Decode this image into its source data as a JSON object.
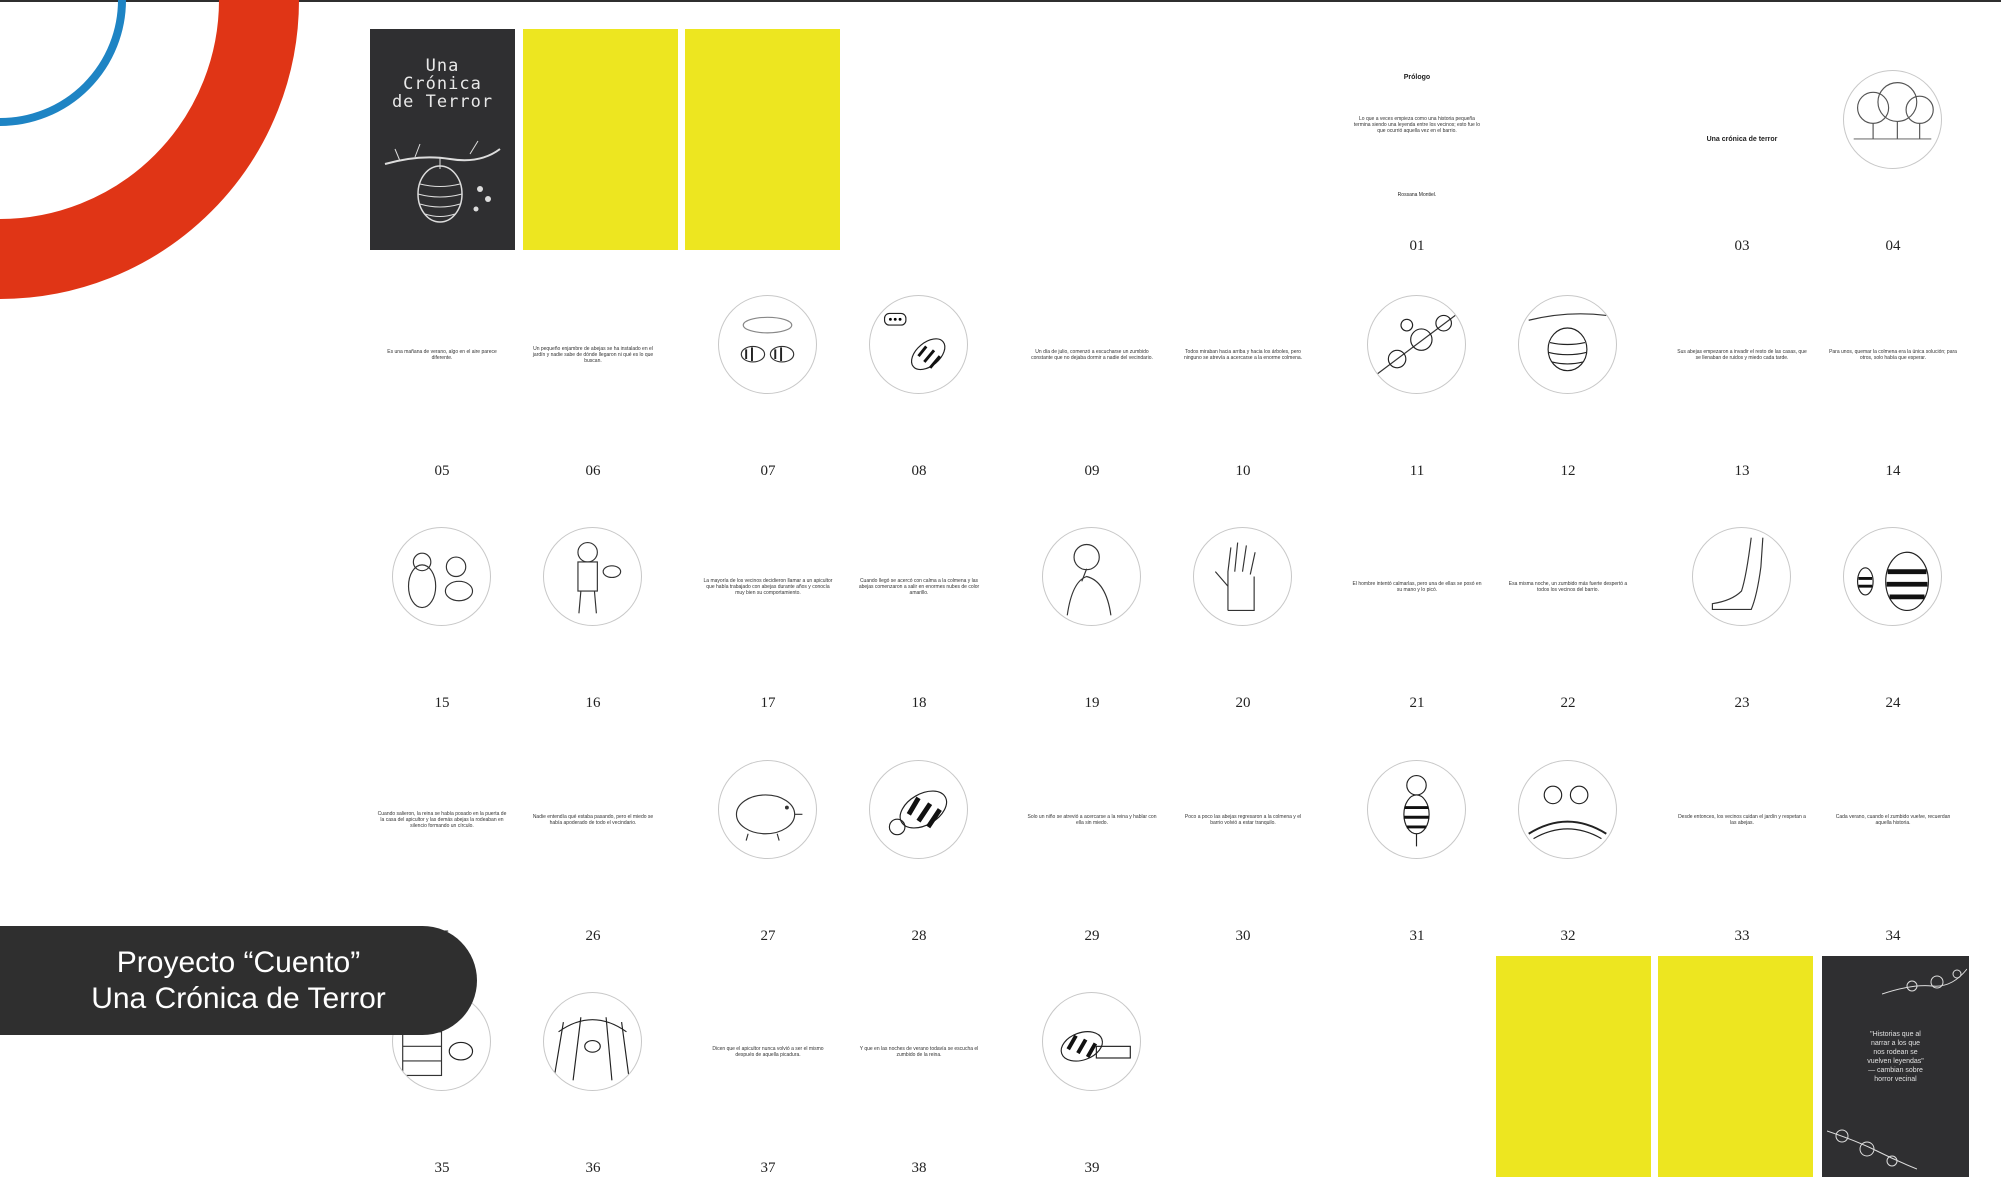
{
  "cover": {
    "title": "Una\nCrónica\nde Terror"
  },
  "back_cover": {
    "quote": "\"Historias que al\nnarrar a los que\nnos rodean se\nvuelven leyendas\"\n— cambian sobre\nhorror vecinal"
  },
  "label": {
    "line1": "Proyecto “Cuento”",
    "line2": "Una Crónica de Terror"
  },
  "pages": [
    {
      "n": "01",
      "kind": "prologue",
      "title": "Prólogo",
      "text": "Lo que a veces empieza como una historia pequeña termina siendo una leyenda entre los vecinos; esto fue lo que ocurrió aquella vez en el barrio.",
      "sig": "Rossana Montiel."
    },
    {
      "n": "03",
      "kind": "title",
      "title": "Una crónica de terror"
    },
    {
      "n": "04",
      "kind": "illus",
      "icon": "trees-icon"
    },
    {
      "n": "05",
      "kind": "text",
      "text": "Es una mañana de verano, algo en el aire parece diferente."
    },
    {
      "n": "06",
      "kind": "text",
      "text": "Un pequeño enjambre de abejas se ha instalado en el jardín y nadie sabe de dónde llegaron ni qué es lo que buscan."
    },
    {
      "n": "07",
      "kind": "illus",
      "icon": "bees-icon"
    },
    {
      "n": "08",
      "kind": "illus",
      "icon": "bee-talking-icon"
    },
    {
      "n": "09",
      "kind": "text",
      "text": "Un día de julio, comenzó a escucharse un zumbido constante que no dejaba dormir a nadie del vecindario."
    },
    {
      "n": "10",
      "kind": "text",
      "text": "Todos miraban hacia arriba y hacia los árboles, pero ninguno se atrevía a acercarse a la enorme colmena."
    },
    {
      "n": "11",
      "kind": "illus",
      "icon": "flowers-icon"
    },
    {
      "n": "12",
      "kind": "illus",
      "icon": "hive-branch-icon"
    },
    {
      "n": "13",
      "kind": "text",
      "text": "Sus abejas empezaron a invadir el resto de las casas, que se llenaban de ruidos y miedo cada tarde."
    },
    {
      "n": "14",
      "kind": "text",
      "text": "Para unos, quemar la colmena era la única solución; para otros, solo había que esperar."
    },
    {
      "n": "15",
      "kind": "illus",
      "icon": "bear-bee-icon"
    },
    {
      "n": "16",
      "kind": "illus",
      "icon": "beekeeper-icon"
    },
    {
      "n": "17",
      "kind": "text",
      "text": "La mayoría de los vecinos decidieron llamar a un apicultor que había trabajado con abejas durante años y conocía muy bien su comportamiento."
    },
    {
      "n": "18",
      "kind": "text",
      "text": "Cuando llegó se acercó con calma a la colmena y las abejas comenzaron a salir en enormes nubes de color amarillo."
    },
    {
      "n": "19",
      "kind": "illus",
      "icon": "man-thinking-icon"
    },
    {
      "n": "20",
      "kind": "illus",
      "icon": "hand-icon"
    },
    {
      "n": "21",
      "kind": "text",
      "text": "El hombre intentó calmarlas, pero una de ellas se posó en su mano y lo picó."
    },
    {
      "n": "22",
      "kind": "text",
      "text": "Esa misma noche, un zumbido más fuerte despertó a todos los vecinos del barrio."
    },
    {
      "n": "23",
      "kind": "illus",
      "icon": "leg-icon"
    },
    {
      "n": "24",
      "kind": "illus",
      "icon": "angry-bees-icon"
    },
    {
      "n": "25",
      "kind": "text",
      "text": "Cuando salieron, la reina se había posado en la puerta de la casa del apicultor y las demás abejas la rodeaban en silencio formando un círculo."
    },
    {
      "n": "26",
      "kind": "text",
      "text": "Nadie entendía qué estaba pasando, pero el miedo se había apoderado de todo el vecindario."
    },
    {
      "n": "27",
      "kind": "illus",
      "icon": "mole-icon"
    },
    {
      "n": "28",
      "kind": "illus",
      "icon": "bee-flying-icon"
    },
    {
      "n": "29",
      "kind": "text",
      "text": "Solo un niño se atrevió a acercarse a la reina y hablar con ella sin miedo."
    },
    {
      "n": "30",
      "kind": "text",
      "text": "Poco a poco las abejas regresaron a la colmena y el barrio volvió a estar tranquilo."
    },
    {
      "n": "31",
      "kind": "illus",
      "icon": "bee-standing-icon"
    },
    {
      "n": "32",
      "kind": "illus",
      "icon": "bees-group-icon"
    },
    {
      "n": "33",
      "kind": "text",
      "text": "Desde entonces, los vecinos cuidan el jardín y respetan a las abejas."
    },
    {
      "n": "34",
      "kind": "text",
      "text": "Cada verano, cuando el zumbido vuelve, recuerdan aquella historia."
    },
    {
      "n": "35",
      "kind": "illus",
      "icon": "bee-building-icon"
    },
    {
      "n": "36",
      "kind": "illus",
      "icon": "forest-bee-icon"
    },
    {
      "n": "37",
      "kind": "text",
      "text": "Dicen que el apicultor nunca volvió a ser el mismo después de aquella picadura."
    },
    {
      "n": "38",
      "kind": "text",
      "text": "Y que en las noches de verano todavía se escucha el zumbido de la reina."
    },
    {
      "n": "39",
      "kind": "illus",
      "icon": "bee-sleeping-icon"
    }
  ],
  "colors": {
    "accent_red": "#e03516",
    "accent_blue": "#1e84c4",
    "yellow": "#ede620",
    "dark": "#2f2f31"
  }
}
